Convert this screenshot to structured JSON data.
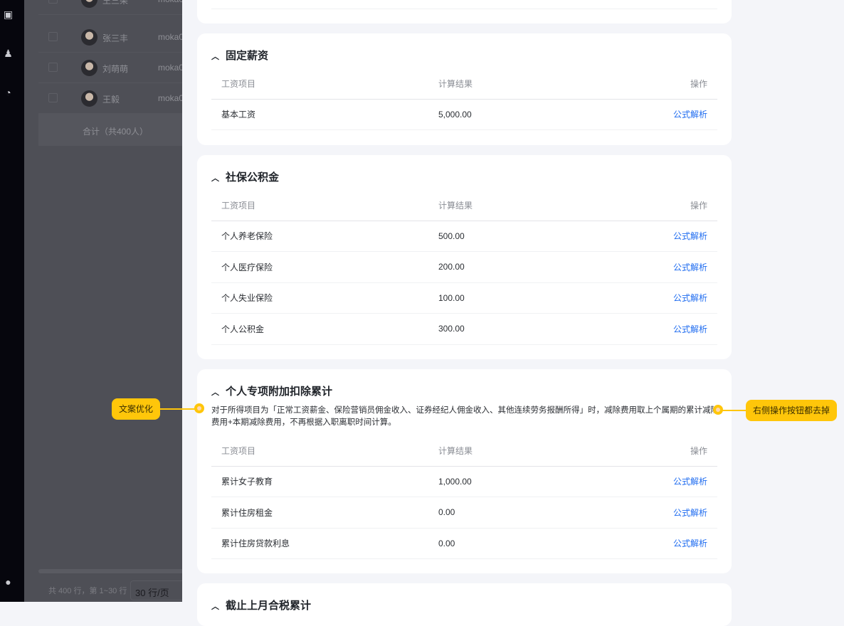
{
  "background": {
    "rows": [
      {
        "name": "王三朵",
        "account": "moka0"
      },
      {
        "name": "张三丰",
        "account": "moka0"
      },
      {
        "name": "刘萌萌",
        "account": "moka0"
      },
      {
        "name": "王毅",
        "account": "moka0"
      }
    ],
    "total": "合计（共400人）",
    "pagination": "共 400 行，第 1~30 行",
    "page_size": "30 行/页"
  },
  "sections": [
    {
      "title": "固定薪资",
      "headers": [
        "工资项目",
        "计算结果",
        "操作"
      ],
      "rows": [
        {
          "item": "基本工资",
          "value": "5,000.00",
          "action": "公式解析"
        }
      ]
    },
    {
      "title": "社保公积金",
      "headers": [
        "工资项目",
        "计算结果",
        "操作"
      ],
      "rows": [
        {
          "item": "个人养老保险",
          "value": "500.00",
          "action": "公式解析"
        },
        {
          "item": "个人医疗保险",
          "value": "200.00",
          "action": "公式解析"
        },
        {
          "item": "个人失业保险",
          "value": "100.00",
          "action": "公式解析"
        },
        {
          "item": "个人公积金",
          "value": "300.00",
          "action": "公式解析"
        }
      ]
    },
    {
      "title": "个人专项附加扣除累计",
      "description": "对于所得项目为「正常工资薪金、保险营销员佣金收入、证券经纪人佣金收入、其他连续劳务报酬所得」时，减除费用取上个属期的累计减除费用+本期减除费用，不再根据入职离职时间计算。",
      "headers": [
        "工资项目",
        "计算结果",
        "操作"
      ],
      "rows": [
        {
          "item": "累计女子教育",
          "value": "1,000.00",
          "action": "公式解析"
        },
        {
          "item": "累计住房租金",
          "value": "0.00",
          "action": "公式解析"
        },
        {
          "item": "累计住房贷款利息",
          "value": "0.00",
          "action": "公式解析"
        }
      ]
    },
    {
      "title": "截止上月合税累计"
    }
  ],
  "annotations": {
    "left": "文案优化",
    "right": "右侧操作按钮都去掉"
  },
  "colors": {
    "accent": "#1f6cf0",
    "annotation": "#ffc60a"
  }
}
